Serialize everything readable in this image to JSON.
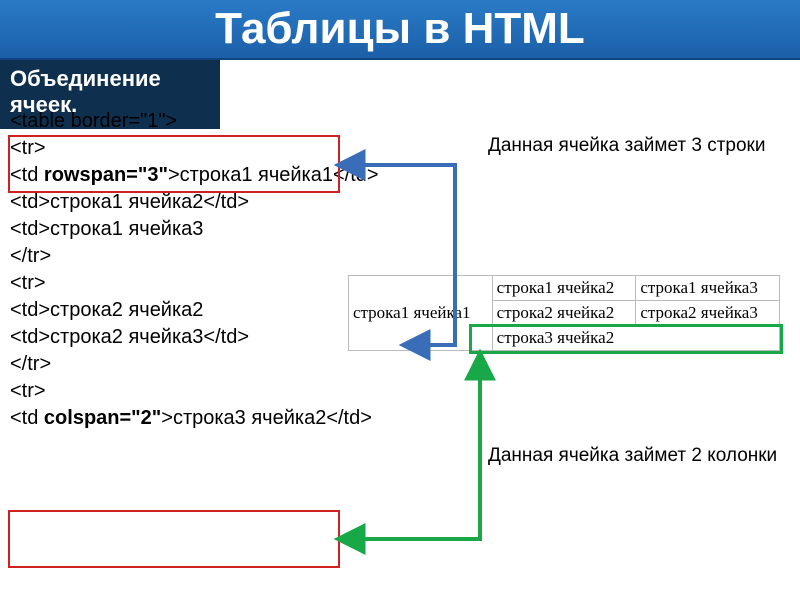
{
  "title": "Таблицы в HTML",
  "subtitle": "Объединение ячеек.",
  "code": {
    "l1": "<table border=\"1\">",
    "l2": "<tr>",
    "l3a": "<td ",
    "l3b": "rowspan=\"3\"",
    "l3c": ">строка1 ячейка1</td>",
    "l4": "<td>строка1 ячейка2</td>",
    "l5": "<td>строка1 ячейка3",
    "l6": "</tr>",
    "l7": "<tr>",
    "l8": "<td>строка2 ячейка2",
    "l9": "<td>строка2 ячейка3</td>",
    "l10": "</tr>",
    "l11": "<tr>",
    "l12a": "<td ",
    "l12b": "colspan=\"2\"",
    "l12c": ">строка3 ячейка2</td>"
  },
  "annotations": {
    "top": "Данная ячейка займет 3 строки",
    "bottom": "Данная ячейка займет 2 колонки"
  },
  "result": {
    "r1c1": "строка1 ячейка1",
    "r1c2": "строка1 ячейка2",
    "r1c3": "строка1 ячейка3",
    "r2c2": "строка2 ячейка2",
    "r2c3": "строка2 ячейка3",
    "r3c2": "строка3 ячейка2"
  },
  "colors": {
    "title_bg": "#1b5fa8",
    "subtitle_bg": "#0f2f4f",
    "red": "#d02020",
    "green": "#18a848",
    "blue_arrow": "#3a6db8"
  }
}
